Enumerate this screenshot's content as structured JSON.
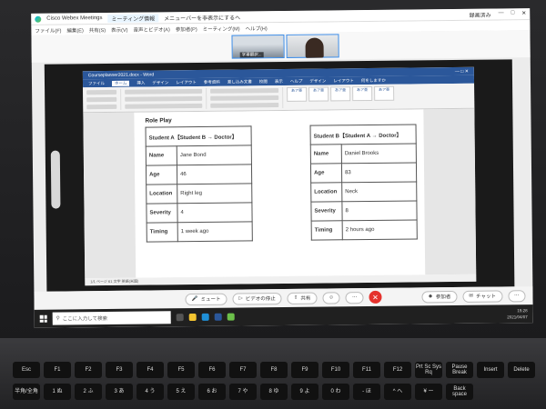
{
  "webex": {
    "app_title": "Cisco Webex Meetings",
    "tab_label": "ミーティング情報",
    "hint": "メニューバーを非表示にするへ",
    "recording": "録画済み",
    "menu": [
      "ファイル(F)",
      "編集(E)",
      "共有(S)",
      "表示(V)",
      "音声とビデオ(A)",
      "参加者(P)",
      "ミーティング(M)",
      "ヘルプ(H)"
    ],
    "thumb_name": "字幕翻訳...",
    "controls": {
      "mute": "ミュート",
      "stop_video": "ビデオの停止",
      "share": "共有",
      "participants": "参加者",
      "chat": "チャット"
    }
  },
  "word": {
    "title": "Courseplanner2021.docx - Word",
    "tabs": [
      "ファイル",
      "ホーム",
      "挿入",
      "デザイン",
      "レイアウト",
      "参考資料",
      "差し込み文書",
      "校閲",
      "表示",
      "ヘルプ",
      "デザイン",
      "レイアウト",
      "何をしますか"
    ],
    "active_tab": "ホーム",
    "styles": [
      "あア亜",
      "あア亜",
      "あア亜",
      "あア亜",
      "あア亜"
    ],
    "status": "1/1 ページ  61 文字  英語(米国)"
  },
  "document": {
    "heading": "Role Play",
    "student_a": {
      "header": "Student A【Student B → Doctor】",
      "rows": [
        {
          "label": "Name",
          "value": "Jane Bond"
        },
        {
          "label": "Age",
          "value": "46"
        },
        {
          "label": "Location",
          "value": "Right leg"
        },
        {
          "label": "Severity",
          "value": "4"
        },
        {
          "label": "Timing",
          "value": "1 week ago"
        }
      ]
    },
    "student_b": {
      "header": "Student B【Student A → Doctor】",
      "rows": [
        {
          "label": "Name",
          "value": "Daniel Brooks"
        },
        {
          "label": "Age",
          "value": "83"
        },
        {
          "label": "Location",
          "value": "Neck"
        },
        {
          "label": "Severity",
          "value": "8"
        },
        {
          "label": "Timing",
          "value": "2 hours ago"
        }
      ]
    }
  },
  "taskbar": {
    "search_placeholder": "ここに入力して検索",
    "time": "15:28",
    "date": "2021/04/07"
  },
  "keyboard": {
    "fn_row": [
      "Esc",
      "F1",
      "F2",
      "F3",
      "F4",
      "F5",
      "F6",
      "F7",
      "F8",
      "F9",
      "F10",
      "F11",
      "F12",
      "Prt Sc Sys Rq",
      "Pause Break",
      "Insert",
      "Delete"
    ],
    "num_row": [
      "半角/全角",
      "1 ぬ",
      "2 ふ",
      "3 あ",
      "4 う",
      "5 え",
      "6 お",
      "7 や",
      "8 ゆ",
      "9 よ",
      "0 わ",
      "- ほ",
      "^ へ",
      "¥ ー",
      "Back space"
    ]
  },
  "colors": {
    "word_blue": "#2b579a",
    "webex_red": "#e5322d",
    "taskbar": "#202020"
  }
}
